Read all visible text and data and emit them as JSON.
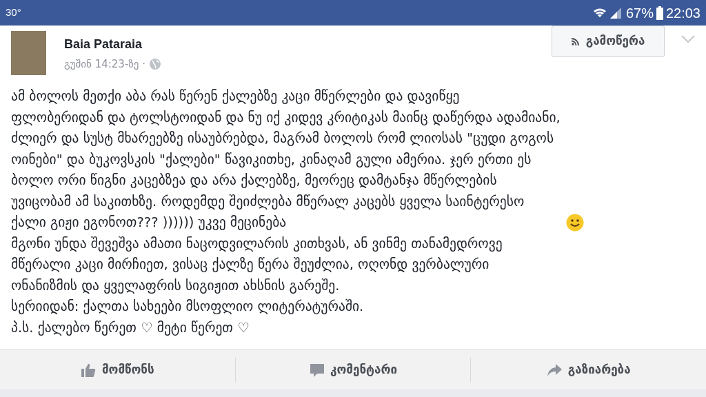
{
  "status_bar": {
    "temperature": "30°",
    "battery": "67%",
    "time": "22:03"
  },
  "post": {
    "author": "Baia Pataraia",
    "time": "გუშინ 14:23-ზე ·",
    "follow_button": "გამოწერა",
    "paragraphs": [
      "ამ ბოლოს მეთქი აბა რას წერენ ქალებზე კაცი მწერლები და დავიწყე\nფლობერიდან და ტოლსტოიდან და ნუ იქ კიდევ კრიტიკას მაინც დაწერდა ადამიანი,\nძლიერ და სუსტ მხარეებზე ისაუბრებდა, მაგრამ ბოლოს რომ ლიოსას \"ცუდი გოგოს\nოინები\" და ბუკოვსკის \"ქალები\" წავიკითხე, კინაღამ გული ამერია. ჯერ ერთი ეს\nბოლო ორი წიგნი კაცებზეა და არა ქალებზე, მეორეც დამტანჯა მწერლების\nუვიცობამ ამ საკითხზე. როდემდე შეიძლება მწერალ კაცებს ყველა საინტერესო\nქალი გიჟი ეგონოთ??? )))))) უკვე მეცინება",
      "მგონი უნდა შევეშვა ამათი ნაცოდვილარის კითხვას, ან ვინმე თანამედროვე\nმწერალი კაცი მირჩიეთ, ვისაც ქალზე წერა შეუძლია, ოღონდ ვერბალური\nონანიზმის და ყველაფრის სიგიჟით ახსნის გარეშე.",
      "სერიიდან: ქალთა სახეები მსოფლიო ლიტერატურაში.",
      "პ.ს. ქალებო წერეთ ♡ მეტი წერეთ ♡"
    ]
  },
  "actions": [
    {
      "kind": "like",
      "label": "მომწონს"
    },
    {
      "kind": "comment",
      "label": "კომენტარი"
    },
    {
      "kind": "share",
      "label": "გაზიარება"
    }
  ]
}
